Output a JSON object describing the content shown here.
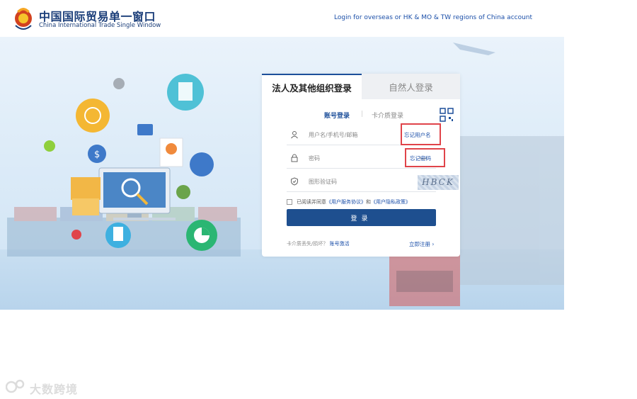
{
  "header": {
    "logo_cn": "中国国际贸易单一窗口",
    "logo_en": "China International Trade Single Window",
    "overseas_link": "Login for overseas or HK & MO & TW regions of China account"
  },
  "login": {
    "tabs": [
      "法人及其他组织登录",
      "自然人登录"
    ],
    "subtabs": [
      "账号登录",
      "卡介质登录"
    ],
    "subtab_separator": "|",
    "username_placeholder": "用户名/手机号/邮箱",
    "forgot_username": "忘记用户名",
    "password_placeholder": "密码",
    "forgot_password": "忘记密码",
    "captcha_placeholder": "图形验证码",
    "captcha_text": "HBCK",
    "agree_prefix": "已阅读并同意",
    "agree_link1": "《用户服务协议》",
    "agree_and": "和",
    "agree_link2": "《用户隐私政策》",
    "login_button": "登录",
    "card_lost": "卡介质丢失/损坏？",
    "account_activate": "账号激活",
    "register": "立即注册",
    "register_arrow": "›"
  },
  "watermark": {
    "text": "大数跨境"
  },
  "colors": {
    "primary": "#1e4f8f",
    "link": "#1a4ea8",
    "highlight": "#e0444a"
  }
}
